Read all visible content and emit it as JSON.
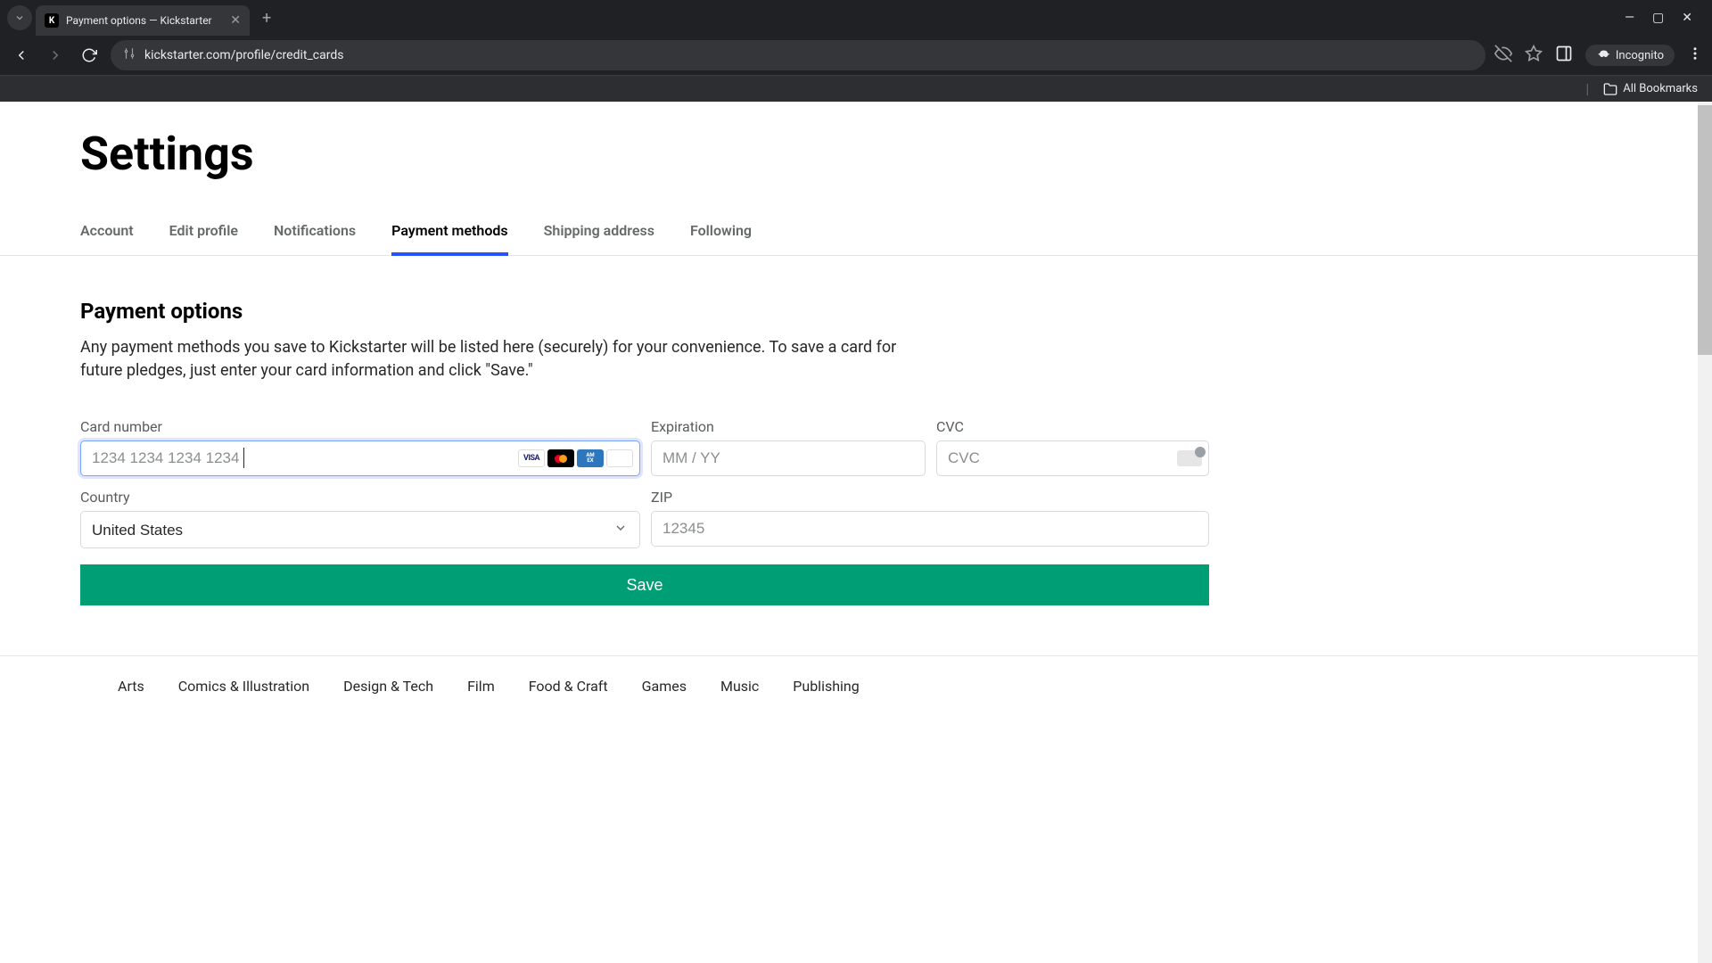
{
  "browser": {
    "tab_title": "Payment options — Kickstarter",
    "url": "kickstarter.com/profile/credit_cards",
    "incognito_label": "Incognito",
    "all_bookmarks": "All Bookmarks"
  },
  "page": {
    "title": "Settings",
    "tabs": [
      {
        "label": "Account"
      },
      {
        "label": "Edit profile"
      },
      {
        "label": "Notifications"
      },
      {
        "label": "Payment methods",
        "active": true
      },
      {
        "label": "Shipping address"
      },
      {
        "label": "Following"
      }
    ],
    "section_title": "Payment options",
    "section_desc": "Any payment methods you save to Kickstarter will be listed here (securely) for your convenience. To save a card for future pledges, just enter your card information and click \"Save.\""
  },
  "form": {
    "card_number": {
      "label": "Card number",
      "placeholder": "1234 1234 1234 1234",
      "value": ""
    },
    "expiration": {
      "label": "Expiration",
      "placeholder": "MM / YY",
      "value": ""
    },
    "cvc": {
      "label": "CVC",
      "placeholder": "CVC",
      "value": ""
    },
    "country": {
      "label": "Country",
      "value": "United States"
    },
    "zip": {
      "label": "ZIP",
      "placeholder": "12345",
      "value": ""
    },
    "save_label": "Save"
  },
  "footer": {
    "categories": [
      "Arts",
      "Comics & Illustration",
      "Design & Tech",
      "Film",
      "Food & Craft",
      "Games",
      "Music",
      "Publishing"
    ]
  }
}
